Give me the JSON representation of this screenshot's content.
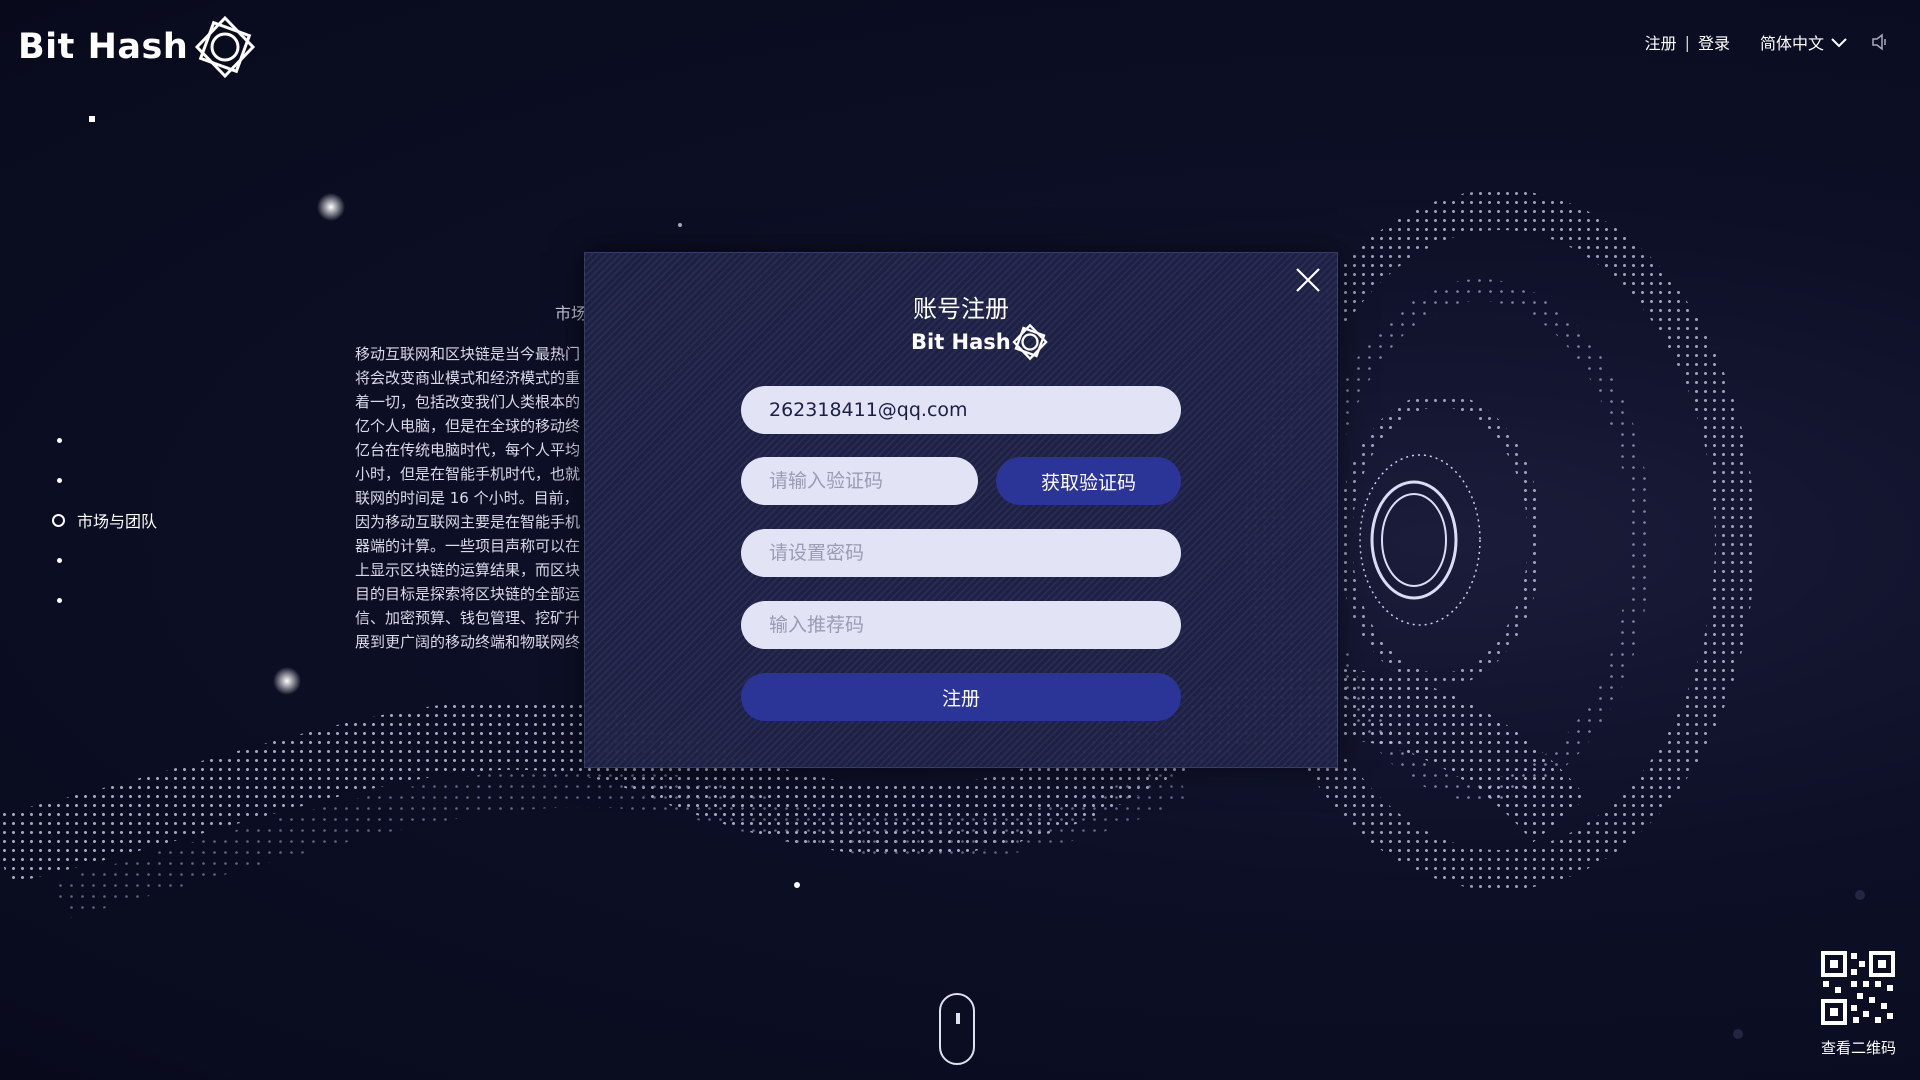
{
  "brand": {
    "name": "Bit Hash"
  },
  "topbar": {
    "register": "注册",
    "separator": "|",
    "login": "登录",
    "language": "简体中文"
  },
  "side_nav": {
    "active_label": "市场与团队"
  },
  "article": {
    "title": "市场",
    "lines": [
      "移动互联网和区块链是当今最热门",
      "将会改变商业模式和经济模式的重",
      "着一切，包括改变我们人类根本的",
      "亿个人电脑，但是在全球的移动终",
      "亿台在传统电脑时代，每个人平均",
      "小时，但是在智能手机时代，也就",
      "联网的时间是 16 个小时。目前，",
      "因为移动互联网主要是在智能手机",
      "器端的计算。一些项目声称可以在",
      "上显示区块链的运算结果，而区块",
      "目的目标是探索将区块链的全部运",
      "信、加密预算、钱包管理、挖矿升",
      "展到更广阔的移动终端和物联网终"
    ]
  },
  "modal": {
    "title": "账号注册",
    "logo_text": "Bit Hash",
    "email_value": "262318411@qq.com",
    "code_placeholder": "请输入验证码",
    "get_code_label": "获取验证码",
    "password_placeholder": "请设置密码",
    "referral_placeholder": "输入推荐码",
    "submit_label": "注册"
  },
  "qr": {
    "label": "查看二维码"
  },
  "colors": {
    "primary_button": "#2b3497",
    "field_bg": "#e2e3f5",
    "page_bg": "#0d0f26"
  }
}
